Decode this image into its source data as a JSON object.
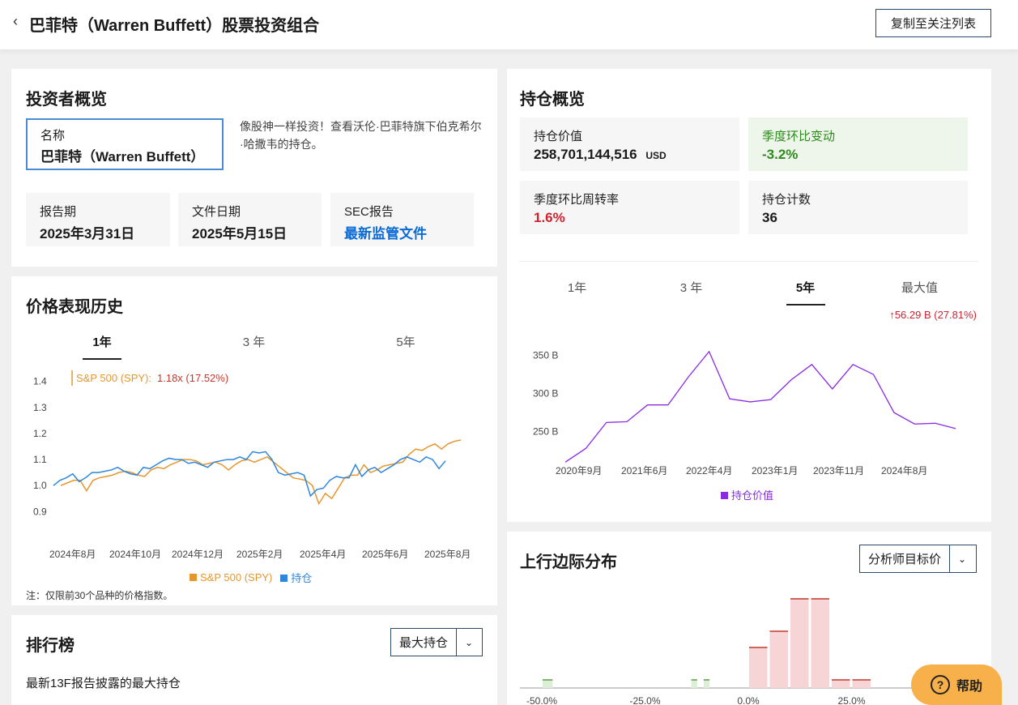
{
  "header": {
    "back": "‹",
    "title": "巴菲特（Warren Buffett）股票投资组合",
    "copy_button": "复制至关注列表"
  },
  "overview": {
    "title": "投资者概览",
    "name_label": "名称",
    "name_value": "巴菲特（Warren Buffett）",
    "description": "像股神一样投资！查看沃伦·巴菲特旗下伯克希尔·哈撒韦的持仓。",
    "report_period_label": "报告期",
    "report_period_value": "2025年3月31日",
    "file_date_label": "文件日期",
    "file_date_value": "2025年5月15日",
    "sec_label": "SEC报告",
    "sec_link": "最新监管文件"
  },
  "holdings": {
    "title": "持仓概览",
    "value_label": "持仓价值",
    "value": "258,701,144,516",
    "value_unit": "USD",
    "qoq_label": "季度环比变动",
    "qoq_value": "-3.2%",
    "turnover_label": "季度环比周转率",
    "turnover_value": "1.6%",
    "count_label": "持仓计数",
    "count_value": "36",
    "tabs": [
      "1年",
      "3 年",
      "5年",
      "最大值"
    ],
    "active_tab": "5年",
    "change_label": "56.29 B (27.81%)",
    "colors": {
      "positive": "#2e8b1e",
      "negative": "#d0222f",
      "line": "#8a2be2"
    }
  },
  "price_history": {
    "title": "价格表现历史",
    "tabs": [
      "1年",
      "3 年",
      "5年"
    ],
    "active_tab": "1年",
    "tooltip_name": "S&P 500 (SPY):",
    "tooltip_value": "1.18x (17.52%)",
    "legend_spy": "S&P 500 (SPY)",
    "legend_holdings": "持仓",
    "note": "注：仅限前30个品种的价格指数。",
    "colors": {
      "spy": "#e5972e",
      "holdings": "#2e86de"
    }
  },
  "ranking": {
    "title": "排行榜",
    "dropdown": "最大持仓",
    "subtitle": "最新13F报告披露的最大持仓"
  },
  "upside": {
    "title": "上行边际分布",
    "dropdown": "分析师目标价"
  },
  "help": {
    "label": "帮助",
    "icon": "?"
  },
  "chart_data": [
    {
      "type": "line",
      "title": "价格表现历史",
      "x_labels": [
        "2024年8月",
        "2024年10月",
        "2024年12月",
        "2025年2月",
        "2025年4月",
        "2025年6月",
        "2025年8月"
      ],
      "y_ticks": [
        "0.9",
        "1.0",
        "1.1",
        "1.2",
        "1.3",
        "1.4"
      ],
      "ylim": [
        0.87,
        1.43
      ],
      "series": [
        {
          "name": "S&P 500 (SPY)",
          "values": [
            1.0,
            1.01,
            1.02,
            1.02,
            0.98,
            1.02,
            1.03,
            1.035,
            1.04,
            1.05,
            1.055,
            1.05,
            1.04,
            1.035,
            1.06,
            1.07,
            1.065,
            1.08,
            1.09,
            1.1,
            1.1,
            1.095,
            1.08,
            1.085,
            1.09,
            1.08,
            1.06,
            1.08,
            1.095,
            1.1,
            1.09,
            1.1,
            1.11,
            1.09,
            1.07,
            1.05,
            1.03,
            1.025,
            1.02,
            1.0,
            0.93,
            0.97,
            0.95,
            0.99,
            1.03,
            1.04,
            1.04,
            1.08,
            1.05,
            1.06,
            1.075,
            1.08,
            1.085,
            1.09,
            1.12,
            1.14,
            1.135,
            1.15,
            1.16,
            1.14,
            1.16,
            1.17,
            1.175
          ]
        },
        {
          "name": "持仓",
          "values": [
            1.0,
            1.02,
            1.03,
            1.045,
            1.015,
            1.03,
            1.05,
            1.05,
            1.055,
            1.06,
            1.07,
            1.055,
            1.045,
            1.04,
            1.07,
            1.065,
            1.08,
            1.095,
            1.105,
            1.1,
            1.1,
            1.085,
            1.09,
            1.08,
            1.07,
            1.09,
            1.095,
            1.1,
            1.1,
            1.11,
            1.1,
            1.13,
            1.125,
            1.13,
            1.1,
            1.05,
            1.04,
            1.045,
            1.05,
            1.04,
            0.96,
            0.985,
            0.99,
            1.02,
            1.035,
            1.03,
            1.03,
            1.08,
            1.035,
            1.06,
            1.07,
            1.05,
            1.065,
            1.08,
            1.1,
            1.11,
            1.1,
            1.09,
            1.11,
            1.1,
            1.065,
            1.095
          ]
        }
      ]
    },
    {
      "type": "line",
      "title": "持仓价值",
      "x_labels": [
        "2020年9月",
        "2021年6月",
        "2022年4月",
        "2023年1月",
        "2023年11月",
        "2024年8月"
      ],
      "y_ticks": [
        "250 B",
        "300 B",
        "350 B"
      ],
      "ylim": [
        205,
        375
      ],
      "series": [
        {
          "name": "持仓价值",
          "values": [
            210,
            228,
            262,
            263,
            285,
            285,
            322,
            355,
            293,
            289,
            292,
            318,
            338,
            306,
            338,
            325,
            275,
            260,
            261,
            254
          ]
        }
      ]
    },
    {
      "type": "bar",
      "title": "上行边际分布",
      "x_labels": [
        "-50.0%",
        "-25.0%",
        "0.0%",
        "25.0%"
      ],
      "bins": [
        -50,
        -25,
        0,
        25
      ],
      "bars": [
        {
          "from": -50,
          "to": -47,
          "count": 1
        },
        {
          "from": -14,
          "to": -12,
          "count": 1
        },
        {
          "from": -11,
          "to": -9,
          "count": 1
        },
        {
          "from": 0,
          "to": 5,
          "count": 5
        },
        {
          "from": 5,
          "to": 10,
          "count": 7
        },
        {
          "from": 10,
          "to": 15,
          "count": 11
        },
        {
          "from": 15,
          "to": 20,
          "count": 11
        },
        {
          "from": 20,
          "to": 25,
          "count": 1
        },
        {
          "from": 25,
          "to": 30,
          "count": 1
        }
      ]
    }
  ]
}
